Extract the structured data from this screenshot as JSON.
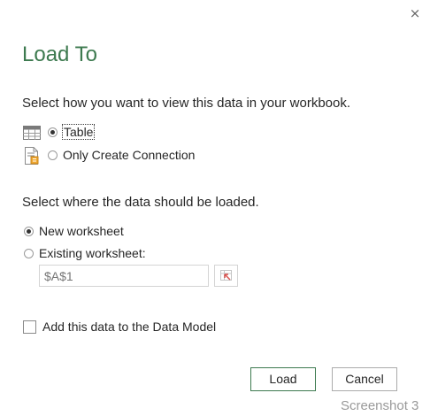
{
  "dialog": {
    "title": "Load To",
    "close_glyph": "×"
  },
  "view_section": {
    "label": "Select how you want to view this data in your workbook.",
    "options": [
      {
        "label": "Table",
        "selected": true,
        "icon": "table-icon"
      },
      {
        "label": "Only Create Connection",
        "selected": false,
        "icon": "connection-icon"
      }
    ]
  },
  "location_section": {
    "label": "Select where the data should be loaded.",
    "options": [
      {
        "label": "New worksheet",
        "selected": true
      },
      {
        "label": "Existing worksheet:",
        "selected": false
      }
    ],
    "cell_reference_placeholder": "$A$1",
    "cell_reference_value": ""
  },
  "data_model": {
    "label": "Add this data to the Data Model",
    "checked": false
  },
  "buttons": {
    "load": "Load",
    "cancel": "Cancel"
  },
  "watermark": "Screenshot 3",
  "colors": {
    "accent": "#3d7a4f",
    "text": "#262626",
    "disabled_text": "#b8b8b8"
  }
}
